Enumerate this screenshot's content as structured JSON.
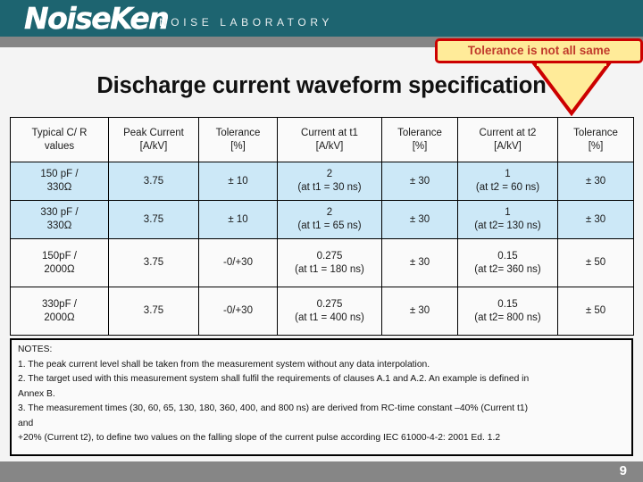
{
  "header": {
    "brand": "NoiseKen",
    "tagline": "NOISE LABORATORY",
    "banner_color": "#1d6470",
    "band_color": "#858585"
  },
  "callout": {
    "text": "Tolerance is not all same",
    "fill_color": "#ffeb99",
    "border_color": "#cc0000",
    "text_color": "#c0392b"
  },
  "title": "Discharge current waveform specification",
  "table": {
    "columns": [
      {
        "line1": "Typical C/ R",
        "line2": "values"
      },
      {
        "line1": "Peak Current",
        "line2": "[A/kV]"
      },
      {
        "line1": "Tolerance",
        "line2": "[%]"
      },
      {
        "line1": "Current at t1",
        "line2": "[A/kV]"
      },
      {
        "line1": "Tolerance",
        "line2": "[%]"
      },
      {
        "line1": "Current at t2",
        "line2": "[A/kV]"
      },
      {
        "line1": "Tolerance",
        "line2": "[%]"
      }
    ],
    "rows": [
      {
        "cr_line1": "150 pF /",
        "cr_line2": "330Ω",
        "peak": "3.75",
        "tol_peak": "± 10",
        "i_t1_line1": "2",
        "i_t1_line2": "(at t1 = 30 ns)",
        "tol_t1": "± 30",
        "i_t2_line1": "1",
        "i_t2_line2": "(at t2 = 60 ns)",
        "tol_t2": "± 30",
        "shade": "blue"
      },
      {
        "cr_line1": "330 pF /",
        "cr_line2": "330Ω",
        "peak": "3.75",
        "tol_peak": "± 10",
        "i_t1_line1": "2",
        "i_t1_line2": "(at t1 = 65 ns)",
        "tol_t1": "± 30",
        "i_t2_line1": "1",
        "i_t2_line2": "(at t2= 130 ns)",
        "tol_t2": "± 30",
        "shade": "blue"
      },
      {
        "cr_line1": "150pF /",
        "cr_line2": "2000Ω",
        "peak": "3.75",
        "tol_peak": "-0/+30",
        "i_t1_line1": "0.275",
        "i_t1_line2": "(at t1 = 180 ns)",
        "tol_t1": "± 30",
        "i_t2_line1": "0.15",
        "i_t2_line2": "(at t2= 360 ns)",
        "tol_t2": "± 50",
        "shade": "white"
      },
      {
        "cr_line1": "330pF /",
        "cr_line2": "2000Ω",
        "peak": "3.75",
        "tol_peak": "-0/+30",
        "i_t1_line1": "0.275",
        "i_t1_line2": "(at t1 = 400 ns)",
        "tol_t1": "± 30",
        "i_t2_line1": "0.15",
        "i_t2_line2": "(at t2= 800 ns)",
        "tol_t2": "± 50",
        "shade": "white"
      }
    ]
  },
  "notes": {
    "heading": "NOTES:",
    "line1": "1. The peak current level shall be taken from the measurement system without any data interpolation.",
    "line2": "2. The target used with this measurement system shall fulfil the requirements of clauses A.1 and A.2. An example is defined in",
    "line3": "Annex B.",
    "line4": "3. The measurement times (30, 60, 65, 130, 180, 360, 400, and 800 ns) are derived from RC-time constant –40% (Current t1)",
    "line5": "and",
    "line6": "+20% (Current t2), to define two values on the falling slope of the current pulse according IEC 61000-4-2: 2001 Ed. 1.2"
  },
  "footer": {
    "page_number": "9",
    "bar_color": "#868686"
  }
}
